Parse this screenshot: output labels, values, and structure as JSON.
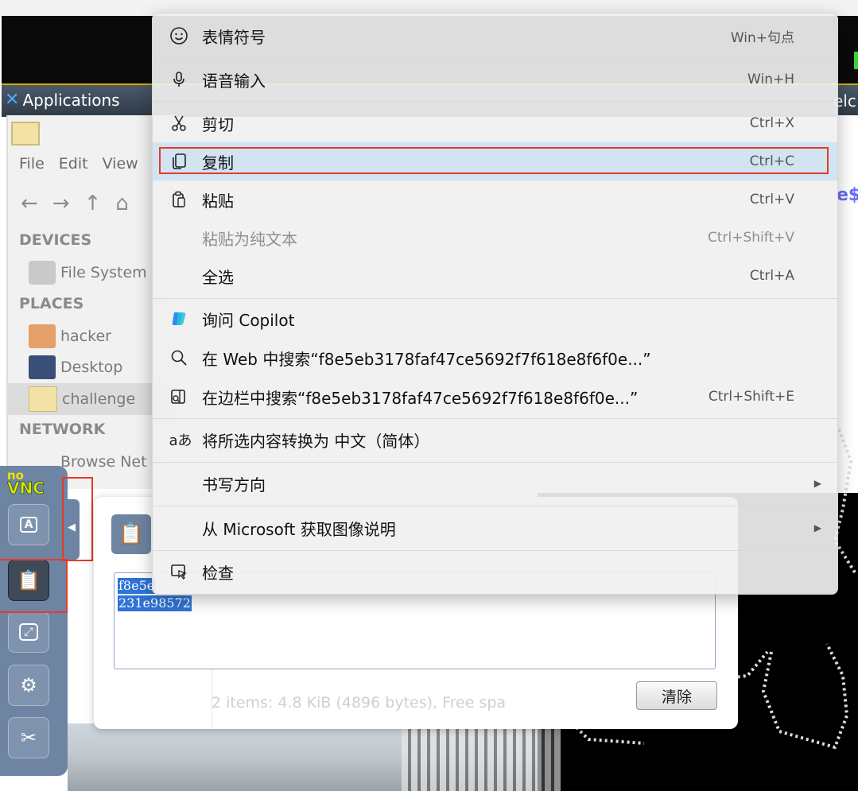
{
  "desktop": {
    "panel": {
      "applications_label": "Applications",
      "window_label_fragment": "elc"
    },
    "file_manager": {
      "menus": [
        "File",
        "Edit",
        "View"
      ],
      "sections": {
        "devices": "DEVICES",
        "places": "PLACES",
        "network": "NETWORK"
      },
      "items": {
        "file_system": "File System",
        "hacker": "hacker",
        "desktop": "Desktop",
        "challenge": "challenge",
        "browse_network": "Browse Net"
      }
    },
    "terminal": {
      "prompt_fragment": "e$"
    }
  },
  "novnc": {
    "logo_no": "no",
    "logo_vnc": "VNC",
    "buttons": [
      "keyboard-icon",
      "clipboard-icon",
      "fullscreen-icon",
      "settings-icon",
      "disconnect-icon"
    ],
    "clipboard": {
      "text_line1": "f8e5e",
      "text_line2": "231e98572",
      "status": "2 items: 4.8 KiB (4896 bytes), Free spa",
      "clear_button": "清除"
    }
  },
  "context_menu": {
    "items": [
      {
        "label": "表情符号",
        "shortcut": "Win+句点",
        "icon": "emoji-icon"
      },
      {
        "label": "语音输入",
        "shortcut": "Win+H",
        "icon": "microphone-icon"
      },
      {
        "label": "剪切",
        "shortcut": "Ctrl+X",
        "icon": "scissors-icon"
      },
      {
        "label": "复制",
        "shortcut": "Ctrl+C",
        "icon": "copy-icon"
      },
      {
        "label": "粘贴",
        "shortcut": "Ctrl+V",
        "icon": "paste-icon"
      },
      {
        "label": "粘贴为纯文本",
        "shortcut": "Ctrl+Shift+V",
        "disabled": true
      },
      {
        "label": "全选",
        "shortcut": "Ctrl+A"
      },
      {
        "label": "询问 Copilot",
        "shortcut": "",
        "icon": "copilot-icon"
      },
      {
        "label": "在 Web 中搜索“f8e5eb3178faf47ce5692f7f618e8f6f0e...”",
        "shortcut": "",
        "icon": "search-icon"
      },
      {
        "label": "在边栏中搜索“f8e5eb3178faf47ce5692f7f618e8f6f0e...”",
        "shortcut": "Ctrl+Shift+E",
        "icon": "sidebar-search-icon"
      },
      {
        "label": "将所选内容转换为 中文（简体）",
        "shortcut": "",
        "icon": "translate-icon"
      },
      {
        "label": "书写方向",
        "shortcut": "",
        "submenu": true
      },
      {
        "label": "从 Microsoft 获取图像说明",
        "shortcut": "",
        "submenu": true
      },
      {
        "label": "检查",
        "shortcut": "",
        "icon": "inspect-icon"
      }
    ]
  },
  "colors": {
    "highlight_box": "#e53a2a",
    "novnc_panel": "#6e84a3",
    "menu_hover": "#d2e3f1"
  }
}
